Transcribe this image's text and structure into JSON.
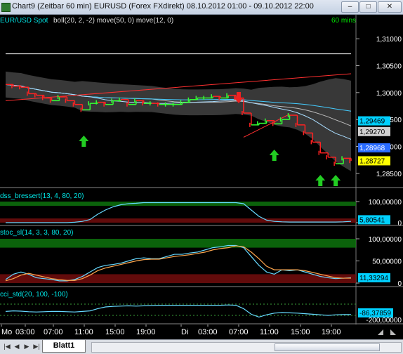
{
  "window": {
    "title": "Chart9 (Zeitbar 60 min)  EURUSD (Forex FXdirekt) 08.10.2012 01:00 - 09.10.2012 22:00"
  },
  "chart": {
    "main_legend_symbol": "EUR/USD Spot",
    "main_legend_studies": "boll(20, 2, -2) move(50, 0) move(12, 0)",
    "interval": "60 mins",
    "price_ticks": [
      "1,31000",
      "1,30500",
      "1,30000",
      "1,29500",
      "1,29000",
      "1,28500"
    ],
    "price_tags": [
      "1,29469",
      "1,29270",
      "1,28968",
      "1,28727"
    ],
    "dss_legend": "dss_bressert(13, 4, 80, 20)",
    "dss_ticks": [
      "100,00000",
      "0"
    ],
    "dss_tag": "5,80541",
    "stoc_legend": "stoc_sl(14, 3, 3, 80, 20)",
    "stoc_ticks": [
      "100,00000",
      "50,00000",
      "0"
    ],
    "stoc_tag": "11,33294",
    "cci_legend": "cci_std(20, 100, -100)",
    "cci_ticks": [
      "-86,37859",
      "-200,00000"
    ],
    "time_labels": [
      "Mo",
      "03:00",
      "07:00",
      "11:00",
      "15:00",
      "19:00",
      "Di",
      "03:00",
      "07:00",
      "11:00",
      "15:00",
      "19:00"
    ]
  },
  "sheet": {
    "tab": "Blatt1"
  },
  "colors": {
    "price_up": "#33ff33",
    "price_down": "#ff2222",
    "band": "#666666",
    "zone_green": "#0e7a0e",
    "zone_red": "#7a0e0e",
    "indicator_line_1": "#66d9ff",
    "indicator_line_2": "#ffa64d"
  },
  "chart_data": [
    {
      "type": "line",
      "panel": "price",
      "title": "EUR/USD Spot",
      "ylim": [
        1.2825,
        1.3125
      ],
      "x": [
        "Mo 01:00",
        "02:00",
        "03:00",
        "04:00",
        "05:00",
        "06:00",
        "07:00",
        "08:00",
        "09:00",
        "10:00",
        "11:00",
        "12:00",
        "13:00",
        "14:00",
        "15:00",
        "16:00",
        "17:00",
        "18:00",
        "19:00",
        "20:00",
        "21:00",
        "22:00",
        "23:00",
        "Di 00:00",
        "01:00",
        "02:00",
        "03:00",
        "04:00",
        "05:00",
        "06:00",
        "07:00",
        "08:00",
        "09:00",
        "10:00",
        "11:00",
        "12:00",
        "13:00",
        "14:00",
        "15:00",
        "16:00",
        "17:00",
        "18:00",
        "19:00",
        "20:00",
        "21:00",
        "22:00"
      ],
      "series": [
        {
          "values": [
            1.3015,
            1.3012,
            1.301,
            1.2998,
            1.2995,
            1.299,
            1.2985,
            1.2992,
            1.2985,
            1.2978,
            1.2968,
            1.298,
            1.2982,
            1.2978,
            1.2985,
            1.2987,
            1.2978,
            1.2985,
            1.298,
            1.298,
            1.2978,
            1.2978,
            1.2978,
            1.2982,
            1.2987,
            1.299,
            1.299,
            1.2993,
            1.299,
            1.2995,
            1.299,
            1.2962,
            1.294,
            1.2943,
            1.2948,
            1.2942,
            1.295,
            1.2958,
            1.294,
            1.2925,
            1.2908,
            1.2888,
            1.288,
            1.2868,
            1.2878,
            1.2873
          ]
        }
      ]
    },
    {
      "type": "line",
      "panel": "dss_bressert",
      "ylim": [
        0,
        100
      ],
      "series": [
        {
          "values": [
            0,
            0,
            0,
            0,
            0,
            0,
            0,
            0,
            0,
            2,
            6,
            15,
            40,
            60,
            75,
            85,
            90,
            92,
            95,
            95,
            95,
            95,
            95,
            95,
            95,
            95,
            95,
            95,
            95,
            95,
            95,
            90,
            60,
            30,
            12,
            6,
            4,
            3,
            3,
            3,
            3,
            3,
            3,
            3,
            4,
            6
          ]
        }
      ]
    },
    {
      "type": "line",
      "panel": "stoc_sl",
      "ylim": [
        0,
        100
      ],
      "series": [
        {
          "values": [
            8,
            20,
            25,
            20,
            12,
            10,
            8,
            5,
            5,
            8,
            15,
            25,
            35,
            40,
            42,
            45,
            50,
            55,
            57,
            55,
            55,
            60,
            65,
            65,
            68,
            70,
            75,
            80,
            82,
            85,
            85,
            80,
            60,
            40,
            25,
            20,
            30,
            28,
            30,
            25,
            20,
            15,
            12,
            10,
            11,
            12
          ]
        },
        {
          "values": [
            5,
            10,
            18,
            22,
            18,
            14,
            10,
            8,
            6,
            6,
            10,
            18,
            28,
            34,
            38,
            42,
            46,
            50,
            53,
            54,
            54,
            57,
            60,
            62,
            64,
            67,
            70,
            75,
            78,
            80,
            84,
            82,
            70,
            55,
            38,
            30,
            30,
            30,
            30,
            28,
            24,
            20,
            16,
            12,
            11,
            11
          ]
        }
      ]
    },
    {
      "type": "line",
      "panel": "cci_std",
      "ylim": [
        -200,
        200
      ],
      "series": [
        {
          "values": [
            -30,
            -20,
            -25,
            -35,
            -40,
            -35,
            -30,
            -30,
            -35,
            -40,
            -30,
            -20,
            20,
            50,
            60,
            65,
            70,
            65,
            70,
            75,
            80,
            80,
            80,
            80,
            80,
            80,
            80,
            80,
            80,
            85,
            80,
            20,
            -80,
            -130,
            -90,
            -60,
            -50,
            -55,
            -60,
            -70,
            -80,
            -90,
            -100,
            -90,
            -85,
            -86
          ]
        }
      ]
    }
  ]
}
